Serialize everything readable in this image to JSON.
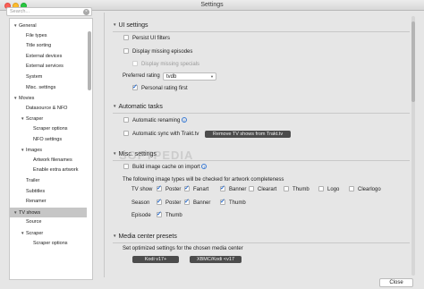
{
  "window": {
    "title": "Settings"
  },
  "sidebar": {
    "search_placeholder": "Search...",
    "tree": [
      {
        "label": "General",
        "expanded": true,
        "level": 0
      },
      {
        "label": "File types",
        "level": 1
      },
      {
        "label": "Title sorting",
        "level": 1
      },
      {
        "label": "External devices",
        "level": 1
      },
      {
        "label": "External services",
        "level": 1
      },
      {
        "label": "System",
        "level": 1
      },
      {
        "label": "Misc. settings",
        "level": 1
      },
      {
        "label": "Movies",
        "expanded": true,
        "level": 0
      },
      {
        "label": "Datasource & NFO",
        "level": 1
      },
      {
        "label": "Scraper",
        "expanded": true,
        "level": 1
      },
      {
        "label": "Scraper options",
        "level": 2
      },
      {
        "label": "NFO settings",
        "level": 2
      },
      {
        "label": "Images",
        "expanded": true,
        "level": 1
      },
      {
        "label": "Artwork filenames",
        "level": 2
      },
      {
        "label": "Enable extra artwork",
        "level": 2
      },
      {
        "label": "Trailer",
        "level": 1
      },
      {
        "label": "Subtitles",
        "level": 1
      },
      {
        "label": "Renamer",
        "level": 1
      },
      {
        "label": "TV shows",
        "expanded": true,
        "level": 0,
        "selected": true
      },
      {
        "label": "Source",
        "level": 1
      },
      {
        "label": "Scraper",
        "expanded": true,
        "level": 1
      },
      {
        "label": "Scraper options",
        "level": 2
      }
    ]
  },
  "ui_settings": {
    "title": "UI settings",
    "persist_ui_filters": {
      "label": "Persist UI filters",
      "checked": false
    },
    "display_missing_episodes": {
      "label": "Display missing episodes",
      "checked": false
    },
    "display_missing_specials": {
      "label": "Display missing specials",
      "checked": false,
      "disabled": true
    },
    "preferred_rating": {
      "label": "Preferred rating",
      "value": "tvdb"
    },
    "personal_rating_first": {
      "label": "Personal rating first",
      "checked": true
    }
  },
  "automatic_tasks": {
    "title": "Automatic tasks",
    "automatic_renaming": {
      "label": "Automatic renaming",
      "checked": false
    },
    "automatic_sync_trakt": {
      "label": "Automatic sync with Trakt.tv",
      "checked": false
    },
    "remove_trakt_button": "Remove TV shows from Trakt.tv"
  },
  "misc_settings": {
    "title": "Misc. settings",
    "build_image_cache": {
      "label": "Build image cache on import",
      "checked": false
    },
    "artwork_note": "The following image types will be checked for artwork completeness",
    "rows": [
      {
        "label": "TV show",
        "items": [
          {
            "label": "Poster",
            "checked": true
          },
          {
            "label": "Fanart",
            "checked": true
          },
          {
            "label": "Banner",
            "checked": true
          },
          {
            "label": "Clearart",
            "checked": false
          },
          {
            "label": "Thumb",
            "checked": false
          },
          {
            "label": "Logo",
            "checked": false
          },
          {
            "label": "Clearlogo",
            "checked": false
          }
        ]
      },
      {
        "label": "Season",
        "items": [
          {
            "label": "Poster",
            "checked": true
          },
          {
            "label": "Banner",
            "checked": true
          },
          {
            "label": "Thumb",
            "checked": true
          }
        ]
      },
      {
        "label": "Episode",
        "items": [
          {
            "label": "Thumb",
            "checked": true
          }
        ]
      }
    ]
  },
  "media_center_presets": {
    "title": "Media center presets",
    "description": "Set optimized settings for the chosen media center",
    "buttons": [
      "Kodi v17+",
      "XBMC/Kodi <v17"
    ]
  },
  "footer": {
    "close_label": "Close"
  },
  "watermark": "SOFTPEDIA",
  "colors": {
    "accent": "#2d6fcf",
    "selected_row": "#c6c6c6",
    "dark_button": "#4c4c4c"
  }
}
